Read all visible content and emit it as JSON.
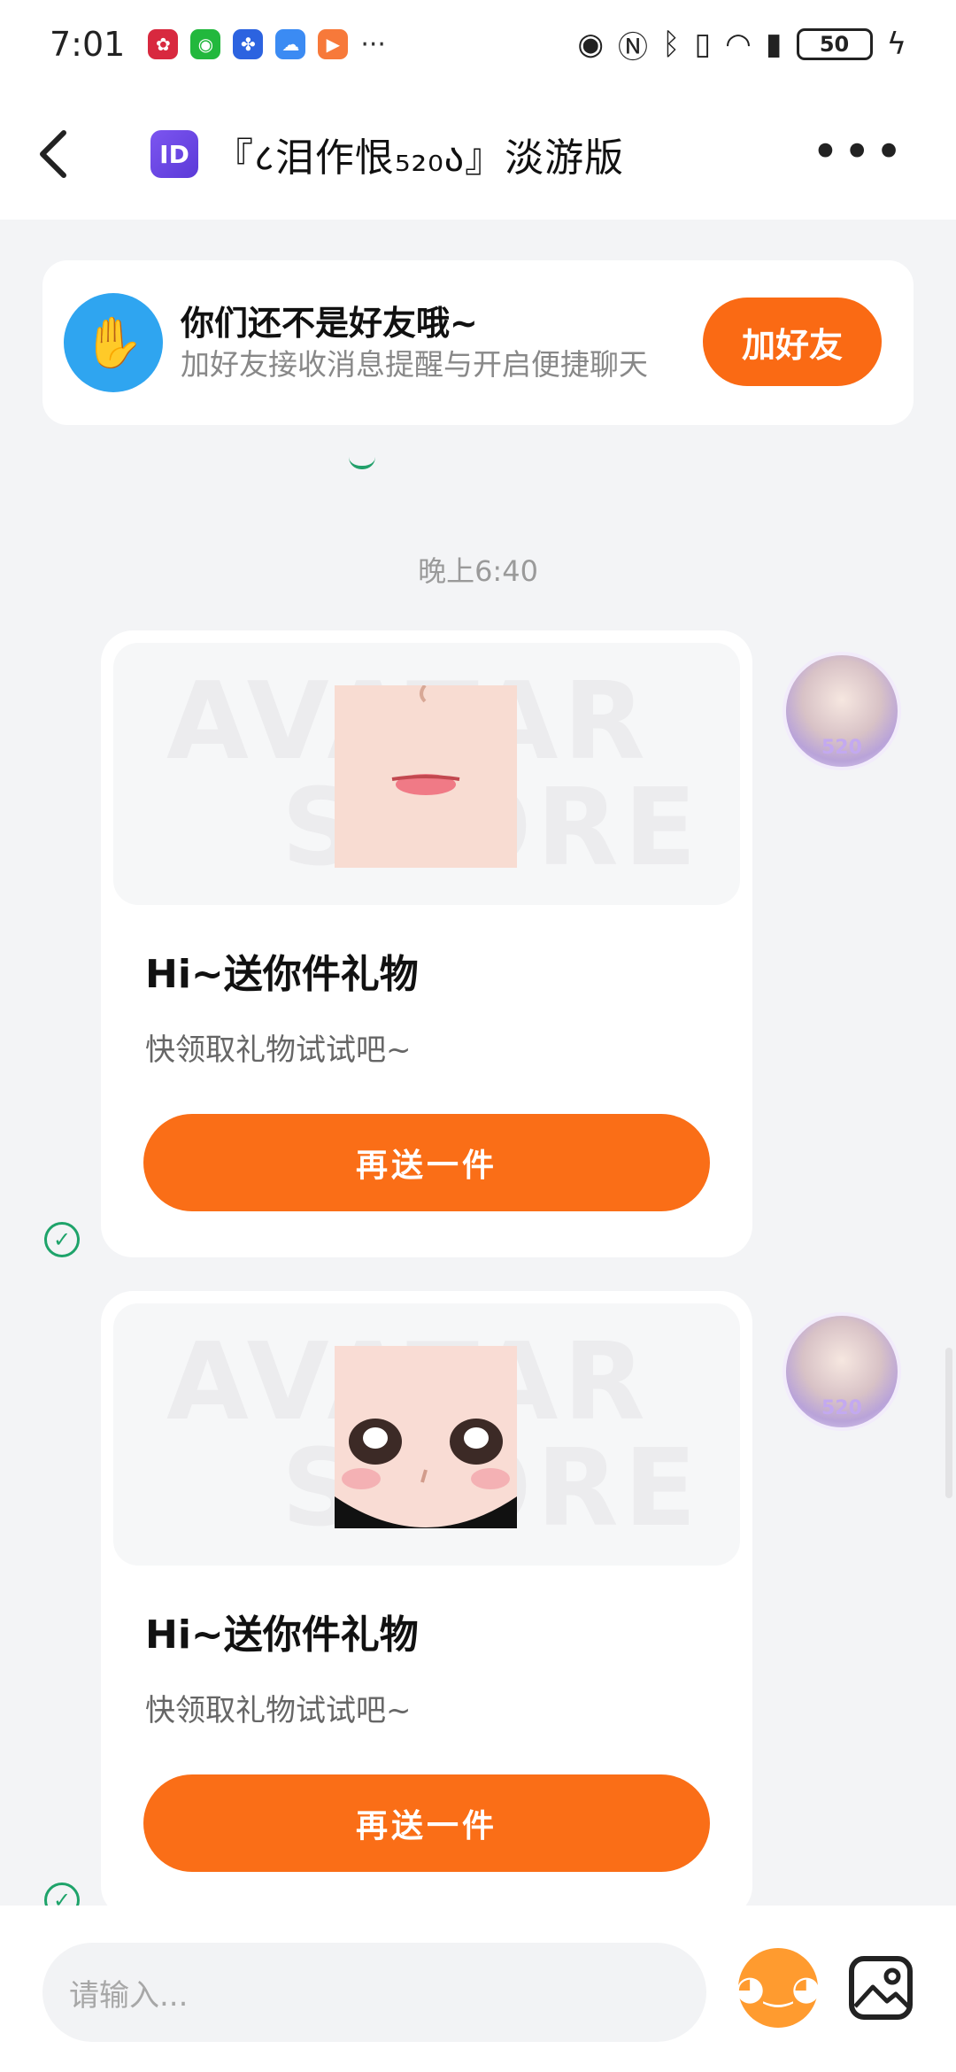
{
  "status_bar": {
    "time": "7:01",
    "battery": "50",
    "app_icons": [
      "huawei-app-icon",
      "wechat-icon",
      "baidu-icon",
      "cloud-icon",
      "video-icon"
    ],
    "more": "···"
  },
  "header": {
    "id_badge": "ID",
    "title": "『८泪作恨₅₂₀ა』淡游版",
    "more": "•••"
  },
  "friend_banner": {
    "title": "你们还不是好友哦~",
    "subtitle": "加好友接收消息提醒与开启便捷聊天",
    "button": "加好友"
  },
  "chat": {
    "timestamp": "晚上6:40",
    "messages": [
      {
        "title": "Hi~送你件礼物",
        "subtitle": "快领取礼物试试吧~",
        "button": "再送一件",
        "watermark1": "AVATAR",
        "watermark2": "STORE"
      },
      {
        "title": "Hi~送你件礼物",
        "subtitle": "快领取礼物试试吧~",
        "button": "再送一件",
        "watermark1": "AVATAR",
        "watermark2": "STORE"
      }
    ],
    "avatar_label": "520"
  },
  "input_bar": {
    "placeholder": "请输入..."
  },
  "colors": {
    "accent": "#fa6e17",
    "badge": "#6a47e6",
    "check": "#1ea36a"
  }
}
